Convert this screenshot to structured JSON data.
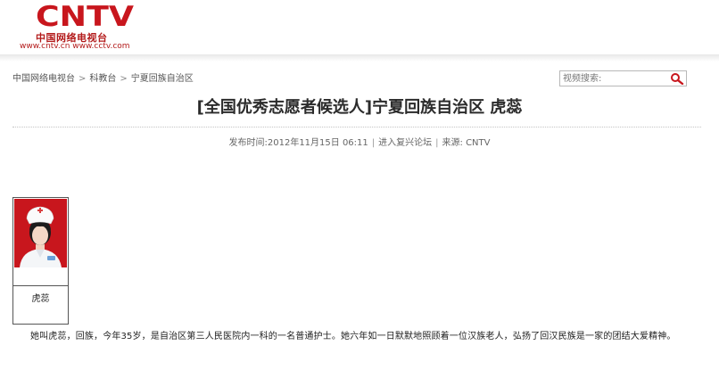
{
  "header": {
    "logo_text": "CNTV",
    "site_name": "中国网络电视台",
    "urls": "www.cntv.cn www.cctv.com",
    "brand_color": "#c8161d"
  },
  "breadcrumb": {
    "items": [
      "中国网络电视台",
      "科教台",
      "宁夏回族自治区"
    ],
    "separator": ">"
  },
  "search": {
    "placeholder": "视频搜索:",
    "icon": "search-icon"
  },
  "article": {
    "title": "[全国优秀志愿者候选人]宁夏回族自治区 虎蕊",
    "publish_time": "发布时间:2012年11月15日 06:11",
    "forum_link": "进入复兴论坛",
    "source": "来源: CNTV",
    "photo_caption": "虎蕊",
    "body": "她叫虎蕊，回族，今年35岁，是自治区第三人民医院内一科的一名普通护士。她六年如一日默默地照顾着一位汉族老人，弘扬了回汉民族是一家的团结大爱精神。"
  }
}
